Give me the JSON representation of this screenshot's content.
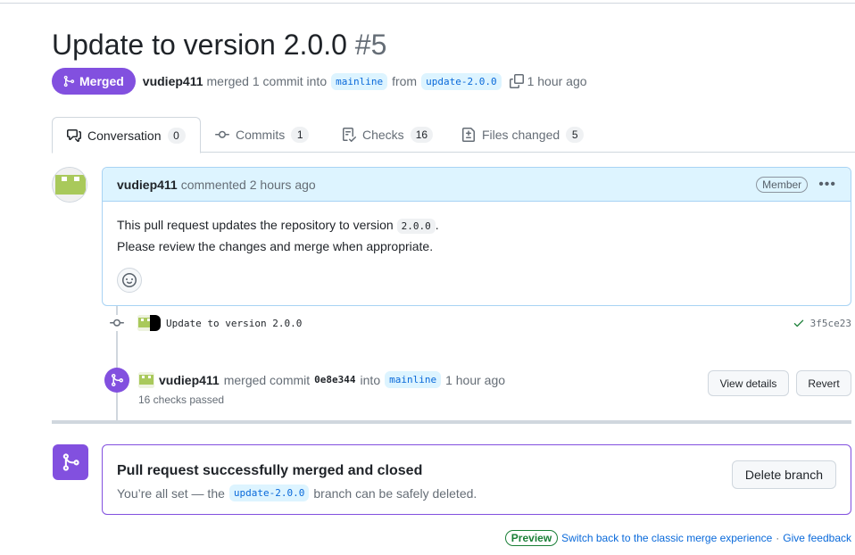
{
  "pr": {
    "title": "Update to version 2.0.0",
    "number": "#5",
    "status": "Merged",
    "author": "vudiep411",
    "merged_text": "merged 1 commit into",
    "base_branch": "mainline",
    "from_text": "from",
    "head_branch": "update-2.0.0",
    "time": "1 hour ago"
  },
  "tabs": [
    {
      "label": "Conversation",
      "count": "0",
      "icon": "conversation-icon"
    },
    {
      "label": "Commits",
      "count": "1",
      "icon": "commit-icon"
    },
    {
      "label": "Checks",
      "count": "16",
      "icon": "checks-icon"
    },
    {
      "label": "Files changed",
      "count": "5",
      "icon": "file-diff-icon"
    }
  ],
  "comment": {
    "author": "vudiep411",
    "action": "commented 2 hours ago",
    "role": "Member",
    "line1_pre": "This pull request updates the repository to version",
    "line1_code": "2.0.0",
    "line1_post": ".",
    "line2": "Please review the changes and merge when appropriate."
  },
  "commit": {
    "message": "Update to version 2.0.0",
    "sha": "3f5ce23"
  },
  "merge_event": {
    "author": "vudiep411",
    "text": "merged commit",
    "sha": "0e8e344",
    "into": "into",
    "branch": "mainline",
    "time": "1 hour ago",
    "checks": "16 checks passed",
    "view_details": "View details",
    "revert": "Revert"
  },
  "merge_box": {
    "title": "Pull request successfully merged and closed",
    "sub_pre": "You’re all set — the",
    "branch": "update-2.0.0",
    "sub_post": "branch can be safely deleted.",
    "delete_button": "Delete branch"
  },
  "footer": {
    "preview": "Preview",
    "switch_link": "Switch back to the classic merge experience",
    "separator": "·",
    "feedback_link": "Give feedback"
  },
  "colors": {
    "merged_purple": "#8250df",
    "link_blue": "#0969da",
    "success_green": "#1a7f37"
  }
}
